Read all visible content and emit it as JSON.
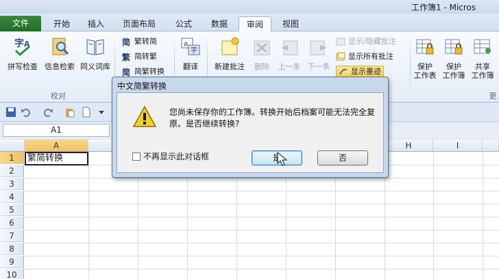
{
  "window": {
    "title": "工作簿1 - Micros"
  },
  "ribbon_tabs": [
    {
      "label": "文件"
    },
    {
      "label": "开始"
    },
    {
      "label": "插入"
    },
    {
      "label": "页面布局"
    },
    {
      "label": "公式"
    },
    {
      "label": "数据"
    },
    {
      "label": "审阅"
    },
    {
      "label": "视图"
    }
  ],
  "ribbon": {
    "proofing": {
      "group_label": "校对",
      "spell_check": "拼写检查",
      "research": "信息检索",
      "thesaurus": "同义词库"
    },
    "chinese": {
      "trad_to_simp": "繁转简",
      "simp_to_trad": "简转繁",
      "convert": "简繁转换"
    },
    "translate": "翻译",
    "comments": {
      "new": "新建批注",
      "delete": "删除",
      "previous": "上一条",
      "next": "下一条",
      "show_hide": "显示/隐藏批注",
      "show_all": "显示所有批注",
      "show_ink": "显示墨迹"
    },
    "changes": {
      "protect_sheet": [
        "保护",
        "工作表"
      ],
      "protect_workbook": [
        "保护",
        "工作簿"
      ],
      "share_workbook": [
        "共享",
        "工作簿"
      ],
      "group_label": "更"
    }
  },
  "formula_bar": {
    "name_box": "A1"
  },
  "grid": {
    "columns": [
      "A",
      "H",
      "I"
    ],
    "rows": [
      "1",
      "2",
      "3",
      "4",
      "5",
      "6",
      "7",
      "8",
      "9",
      "10"
    ],
    "a1_value": "繁简转换"
  },
  "dialog": {
    "title": "中文简繁转换",
    "message": "您尚未保存你的工作簿。转换开始后档案可能无法完全复原。是否继续转换?",
    "checkbox_label": "不再显示此对话框",
    "yes_button": "是",
    "no_button": "否"
  }
}
